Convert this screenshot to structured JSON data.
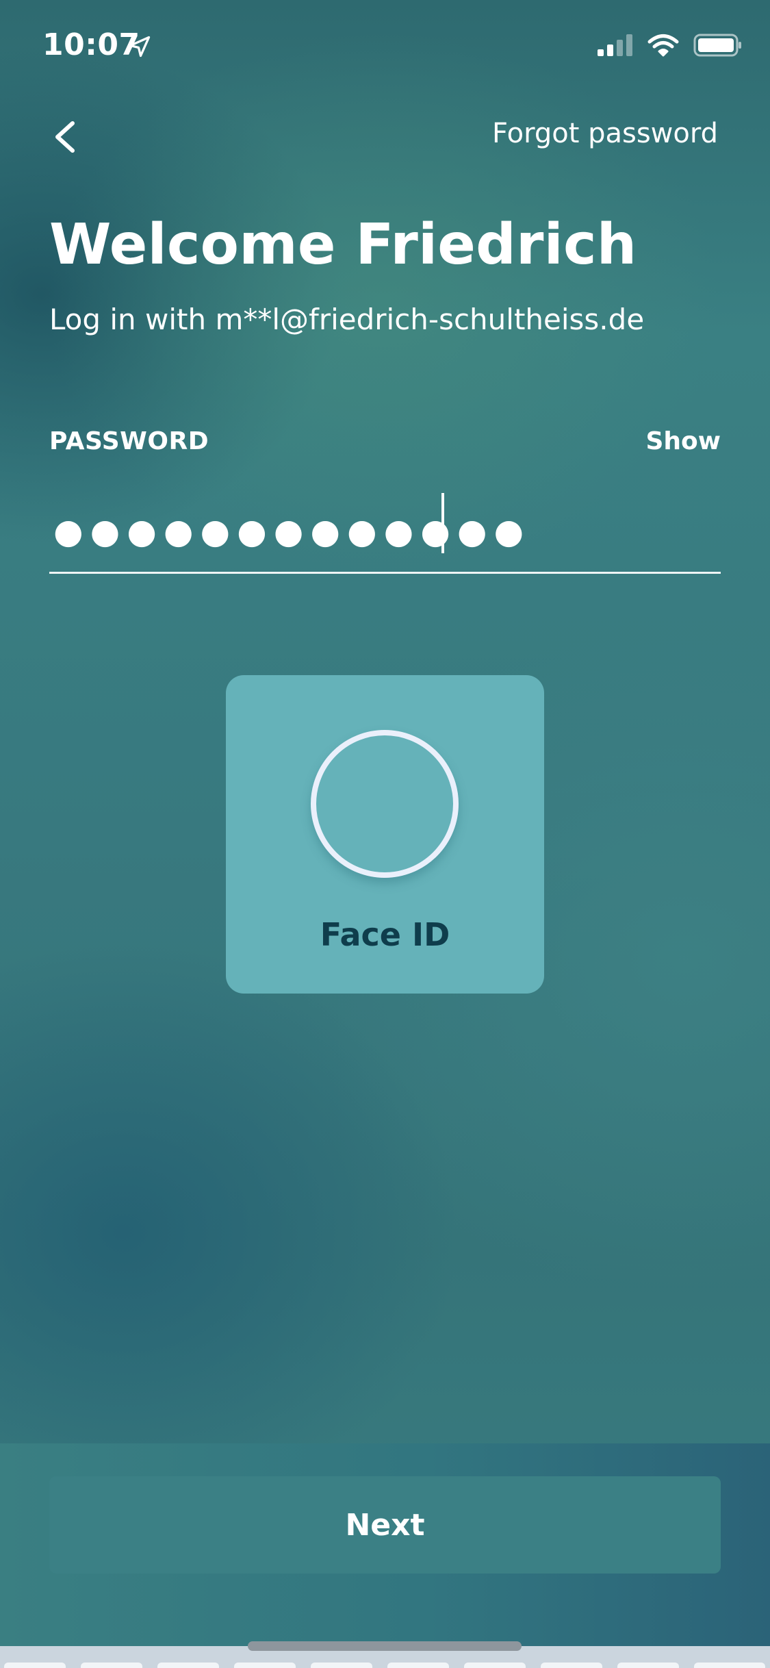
{
  "status_bar": {
    "time": "10:07",
    "icons": [
      "location-arrow-icon",
      "cellular-signal-icon",
      "wifi-icon",
      "battery-icon"
    ]
  },
  "nav": {
    "back_icon": "chevron-left-icon",
    "forgot_password": "Forgot password"
  },
  "header": {
    "title": "Welcome Friedrich",
    "subtitle": "Log in with m**l@friedrich-schultheiss.de"
  },
  "password": {
    "label": "PASSWORD",
    "show_toggle": "Show",
    "masked_value": "●●●●●●●●●●●●●"
  },
  "face_id": {
    "icon": "face-id-ring-icon",
    "label": "Face ID"
  },
  "footer": {
    "next_label": "Next"
  },
  "colors": {
    "background": "#38797f",
    "card": "#65b2b9",
    "card_text": "#0f3d4c",
    "button": "#3b8085"
  }
}
